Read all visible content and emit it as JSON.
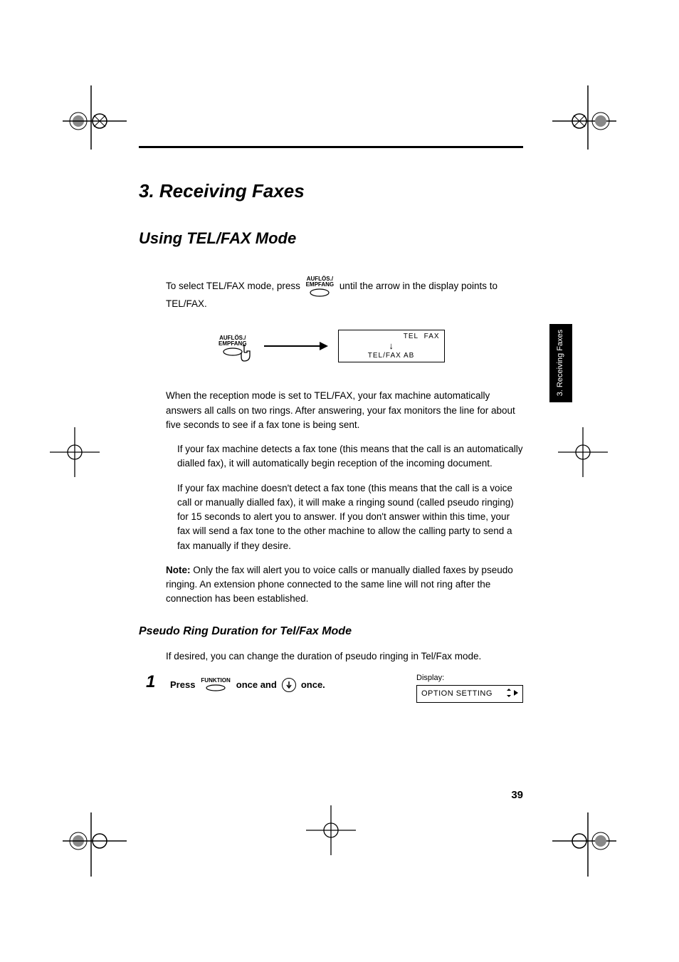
{
  "chapter": {
    "title": "3.  Receiving Faxes"
  },
  "section": {
    "title": "Using TEL/FAX Mode"
  },
  "intro": {
    "part1": "To select TEL/FAX mode, press ",
    "part2": " until the arrow in the display points to TEL/FAX."
  },
  "button_label": "AUFLÖS./\nEMPFANG",
  "lcd": {
    "tel": "TEL",
    "fax": "FAX",
    "bottom": "TEL/FAX   AB"
  },
  "body": {
    "p1": "When the reception mode is set to TEL/FAX, your fax machine automatically answers all calls on two rings. After answering, your fax monitors the line for about five seconds to see if a fax tone is being sent.",
    "p2": "If your fax machine detects a fax tone (this means that the call is an automatically dialled fax), it will automatically begin reception of the incoming document.",
    "p3": "If your fax machine doesn't detect a fax tone (this means that the call is a voice call or manually dialled fax), it will make a ringing sound (called pseudo ringing) for 15 seconds to alert you to answer. If you don't answer within this time, your fax will send a fax tone to the other machine to allow the calling party to send a fax manually if they desire."
  },
  "note": {
    "label": "Note:",
    "text": " Only the fax will alert you to voice calls or manually dialled faxes by pseudo ringing. An extension phone connected to the same line will not ring after the connection has been established."
  },
  "sub": {
    "heading": "Pseudo Ring Duration for Tel/Fax Mode",
    "intro": "If desired, you can change the duration of pseudo ringing in Tel/Fax mode."
  },
  "step1": {
    "num": "1",
    "press": "Press",
    "funktion": "FUNKTION",
    "once_and": "once and",
    "once_end": "once.",
    "display_label": "Display:",
    "display_value": "OPTION SETTING"
  },
  "page_number": "39",
  "side_tab": "3. Receiving\nFaxes"
}
